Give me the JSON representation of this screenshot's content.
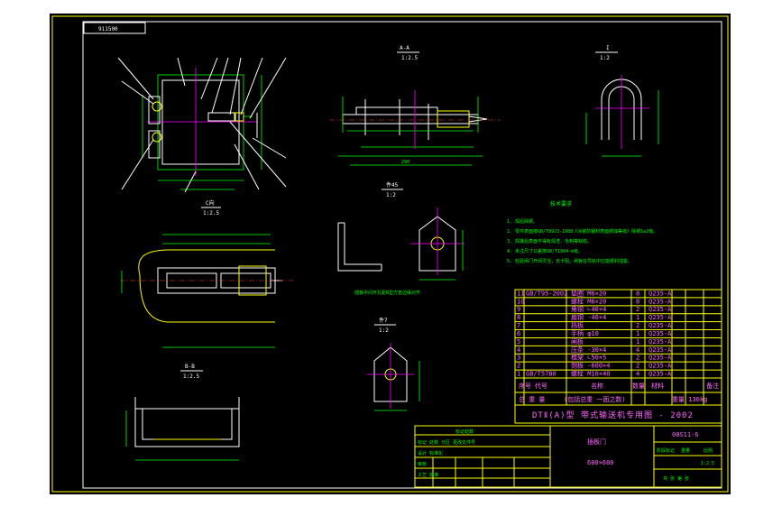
{
  "drawing_number_box": "911500",
  "views": {
    "section_aa": {
      "title": "A-A",
      "scale": "1:2.5",
      "dim_overall": "290"
    },
    "section_i": {
      "title": "I",
      "scale": "1:2"
    },
    "view_c": {
      "title": "C向",
      "scale": "1:2.5"
    },
    "part_45": {
      "title": "件45",
      "scale": "1:2"
    },
    "part_7": {
      "title": "件7",
      "scale": "1:2"
    },
    "section_bb": {
      "title": "B-B",
      "scale": "1:2.5"
    }
  },
  "note_weld": "插板中间开孔距B型方管边缘对齐",
  "tech_requirements": {
    "title": "技术要求",
    "items": [
      "1. 焊后除锈。",
      "2. 零件表面按GB/T8923-1988《涂装前钢材表面锈蚀等级》除锈Sa2级。",
      "3. 焊接后表面不得有焊渣、毛刺等缺陷。",
      "4. 未注尺寸公差按GB/T1804-m级。",
      "5. 检验闸门开闭灵活，无卡阻，闸板在导轨中应能顺利插拔。"
    ]
  },
  "part_rows": [
    {
      "no": "11",
      "code": "GB/T95-2002",
      "name": "垫圈 M6×20",
      "qty": "8",
      "material": "Q235-A"
    },
    {
      "no": "10",
      "code": "",
      "name": "螺栓 M6×20",
      "qty": "8",
      "material": "Q235-A"
    },
    {
      "no": "9",
      "code": "",
      "name": "角钢 ∟40×4",
      "qty": "2",
      "material": "Q235-A"
    },
    {
      "no": "8",
      "code": "",
      "name": "扁钢 -40×4",
      "qty": "1",
      "material": "Q235-A"
    },
    {
      "no": "7",
      "code": "",
      "name": "挡板",
      "qty": "2",
      "material": "Q235-A"
    },
    {
      "no": "6",
      "code": "",
      "name": "手柄 φ10",
      "qty": "1",
      "material": "Q235-A"
    },
    {
      "no": "5",
      "code": "",
      "name": "闸板",
      "qty": "1",
      "material": "Q235-A"
    },
    {
      "no": "4",
      "code": "",
      "name": "压条 -30×4",
      "qty": "4",
      "material": "Q235-A"
    },
    {
      "no": "3",
      "code": "",
      "name": "框架 ∟50×5",
      "qty": "2",
      "material": "Q235-A"
    },
    {
      "no": "2",
      "code": "",
      "name": "侧板 -600×4",
      "qty": "2",
      "material": "Q235-A"
    },
    {
      "no": "1",
      "code": "GB/T5780",
      "name": "螺栓 M10×40",
      "qty": "4",
      "material": "Q235-A"
    }
  ],
  "parts_header": {
    "no": "序号",
    "code": "代号",
    "name": "名称",
    "qty": "数量",
    "material": "材料",
    "remark": "备注"
  },
  "parts_footer": {
    "left": "总 重 量",
    "mid": "(包括总重 一面之数)",
    "right": "重量 136kg"
  },
  "series_title": "DTⅡ(A)型 带式输送机专用图 - 2002",
  "drawing_name": "插板门",
  "drawing_size": "600×600",
  "drawing_code": "00S11-6",
  "title_block": {
    "header": "标记处数",
    "revision_rows": [
      "标记 处数 分区 更改文件号",
      "设计 标准化",
      "审核",
      "工艺 批准"
    ],
    "sheet_info": [
      "阶段标记",
      "重量",
      "比例",
      "共 张 第 张"
    ],
    "scale_value": "1:2.5"
  }
}
